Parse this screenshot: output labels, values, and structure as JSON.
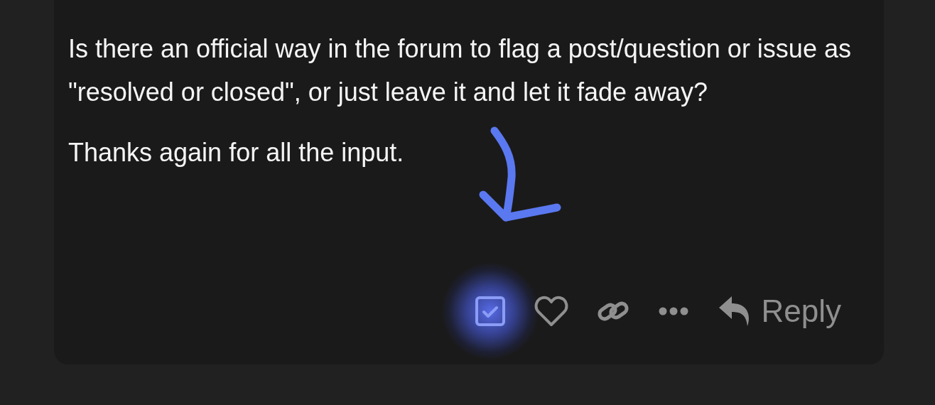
{
  "post": {
    "paragraphs": [
      "Is there an official way in the forum to flag a post/question or issue as \"resolved or closed\", or just leave it and let it fade away?",
      "Thanks again for all the input."
    ]
  },
  "actions": [
    {
      "kind": "solution",
      "highlighted": true
    },
    {
      "kind": "like",
      "highlighted": false
    },
    {
      "kind": "link",
      "highlighted": false
    },
    {
      "kind": "more",
      "highlighted": false
    },
    {
      "kind": "reply",
      "label": "Reply",
      "highlighted": false
    }
  ]
}
